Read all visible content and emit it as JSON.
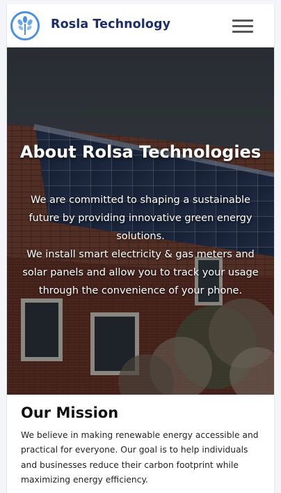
{
  "header": {
    "brand": "Rosla Technology",
    "logo_icon": "tree-leaf-logo-icon",
    "menu_icon": "hamburger-menu-icon"
  },
  "hero": {
    "title": "About Rolsa Technologies",
    "paragraph_1": "We are committed to shaping a sustainable future by providing innovative green energy solutions.",
    "paragraph_2": "We install smart electricity & gas meters and solar panels and allow you to track your usage through the convenience of your phone.",
    "background": "house-roof-solar-panels-photo"
  },
  "mission": {
    "title": "Our Mission",
    "text": "We believe in making renewable energy accessible and practical for everyone. Our goal is to help individuals and businesses reduce their carbon footprint while maximizing energy efficiency."
  },
  "colors": {
    "brand": "#1c2f6b",
    "logo_ring": "#4a90e2",
    "hero_overlay": "#0a0c10"
  }
}
